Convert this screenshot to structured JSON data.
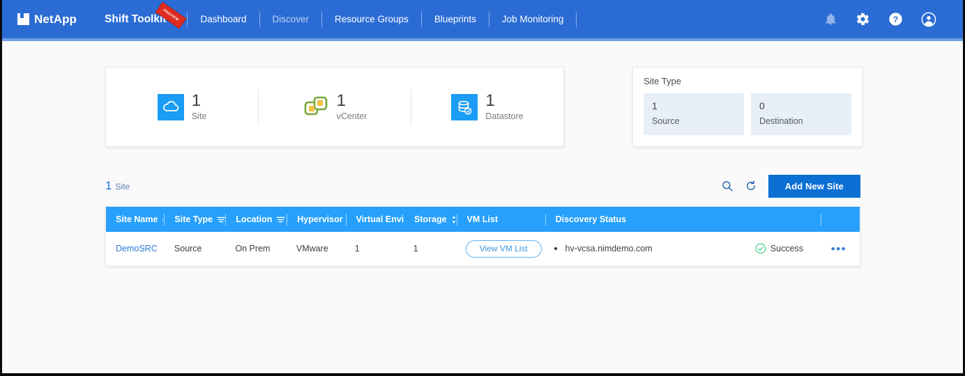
{
  "brand": {
    "name": "NetApp",
    "logo_icon": "netapp-logo-icon"
  },
  "app": {
    "name": "Shift Toolkit",
    "ribbon": "PREVIEW"
  },
  "nav": {
    "items": [
      {
        "label": "Dashboard",
        "active": true
      },
      {
        "label": "Discover",
        "active": false
      },
      {
        "label": "Resource Groups",
        "active": true
      },
      {
        "label": "Blueprints",
        "active": true
      },
      {
        "label": "Job Monitoring",
        "active": true
      }
    ]
  },
  "topbar_icons": [
    {
      "name": "bell-icon",
      "label": "Notifications"
    },
    {
      "name": "gear-icon",
      "label": "Settings"
    },
    {
      "name": "help-icon",
      "label": "Help"
    },
    {
      "name": "user-avatar-icon",
      "label": "Account"
    }
  ],
  "stats": [
    {
      "icon": "cloud-icon",
      "value": "1",
      "label": "Site"
    },
    {
      "icon": "vcenter-icon",
      "value": "1",
      "label": "vCenter"
    },
    {
      "icon": "datastore-icon",
      "value": "1",
      "label": "Datastore"
    }
  ],
  "site_type_card": {
    "title": "Site Type",
    "tiles": [
      {
        "value": "1",
        "label": "Source"
      },
      {
        "value": "0",
        "label": "Destination"
      }
    ]
  },
  "toolbar": {
    "count_number": "1",
    "count_label": "Site",
    "search_icon": "search-icon",
    "refresh_icon": "refresh-icon",
    "add_button": "Add New Site"
  },
  "table": {
    "columns": [
      {
        "label": "Site Name",
        "control": "sort"
      },
      {
        "label": "Site Type",
        "control": "filter"
      },
      {
        "label": "Location",
        "control": "filter"
      },
      {
        "label": "Hypervisor",
        "control": "caret"
      },
      {
        "label": "Virtual Environ",
        "control": "none"
      },
      {
        "label": "Storage",
        "control": "sort"
      },
      {
        "label": "VM List",
        "control": "none"
      },
      {
        "label": "Discovery Status",
        "control": "none"
      }
    ],
    "rows": [
      {
        "site_name": "DemoSRC",
        "site_type": "Source",
        "location": "On Prem",
        "hypervisor": "VMware",
        "virtual_environment": "1",
        "storage": "1",
        "vm_list_button": "View VM List",
        "discovery_host": "hv-vcsa.nimdemo.com",
        "status": "Success",
        "status_icon": "check-circle-icon",
        "actions_icon": "more-actions-icon"
      }
    ]
  },
  "colors": {
    "header_blue": "#2b6cd4",
    "table_header_blue": "#27a0fb",
    "accent_blue": "#0b6fd4",
    "link_blue": "#2a7bd6",
    "success_green": "#3fd08a",
    "ribbon_red": "#e02b20",
    "page_bg": "#fafafa"
  }
}
